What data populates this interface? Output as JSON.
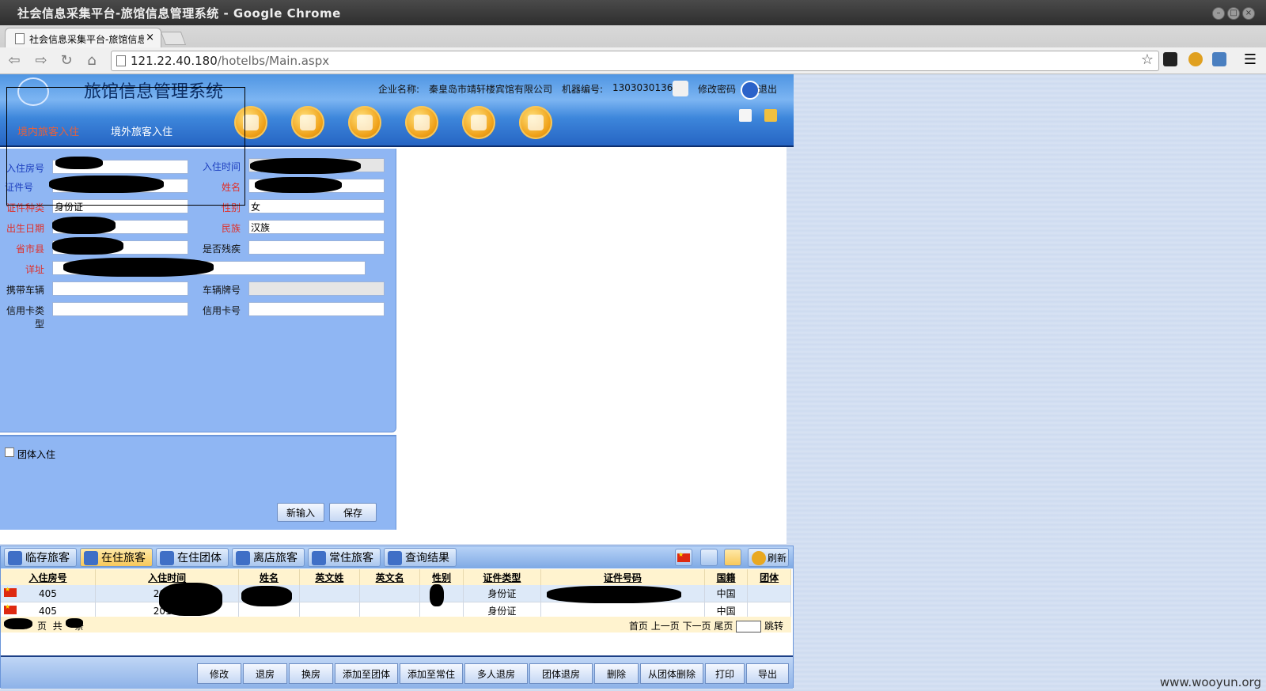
{
  "window": {
    "title": "社会信息采集平台-旅馆信息管理系统 - Google Chrome"
  },
  "browser": {
    "tab_title": "社会信息采集平台-旅馆信息",
    "tab_close": "×",
    "url_host": "121.22.40.180",
    "url_path": "/hotelbs/Main.aspx"
  },
  "header": {
    "system_name": "旅馆信息管理系统",
    "company_label": "企业名称:",
    "company_name": "秦皇岛市靖轩楼宾馆有限公司",
    "machine_label": "机器编号:",
    "machine_id": "1303030136",
    "change_password": "修改密码",
    "logout": "退出",
    "tabs": [
      "境内旅客入住",
      "境外旅客入住"
    ]
  },
  "form": {
    "room_label": "入住房号",
    "checkin_time_label": "入住时间",
    "id_no_label": "证件号",
    "name_label": "姓名",
    "id_type_label": "证件种类",
    "id_type_value": "身份证",
    "gender_label": "性别",
    "gender_value": "女",
    "birth_label": "出生日期",
    "ethnic_label": "民族",
    "ethnic_value": "汉族",
    "province_label": "省市县",
    "disabled_label": "是否残疾",
    "address_label": "详址",
    "vehicle_label": "携带车辆",
    "plate_label": "车辆牌号",
    "card_type_label": "信用卡类型",
    "card_no_label": "信用卡号"
  },
  "group": {
    "group_checkin_label": "团体入住",
    "new_button": "新输入",
    "save_button": "保存"
  },
  "bottom": {
    "tabs": [
      "临存旅客",
      "在住旅客",
      "在住团体",
      "离店旅客",
      "常住旅客",
      "查询结果"
    ],
    "refresh": "刷新",
    "columns": [
      "入住房号",
      "入住时间",
      "姓名",
      "英文姓",
      "英文名",
      "性别",
      "证件类型",
      "证件号码",
      "国籍",
      "团体"
    ],
    "rows": [
      {
        "room": "405",
        "time": "2013-",
        "id_type": "身份证",
        "nationality": "中国"
      },
      {
        "room": "405",
        "time": "2013-",
        "id_type": "身份证",
        "nationality": "中国"
      }
    ],
    "pager_left_a": "页",
    "pager_left_b": "共",
    "pager_left_c": "条",
    "pager_right": "首页 上一页 下一页 尾页",
    "jump": "跳转",
    "actions": [
      "修改",
      "退房",
      "换房",
      "添加至团体",
      "添加至常住",
      "多人退房",
      "团体退房",
      "删除",
      "从团体删除",
      "打印",
      "导出"
    ]
  },
  "watermark": "www.wooyun.org"
}
